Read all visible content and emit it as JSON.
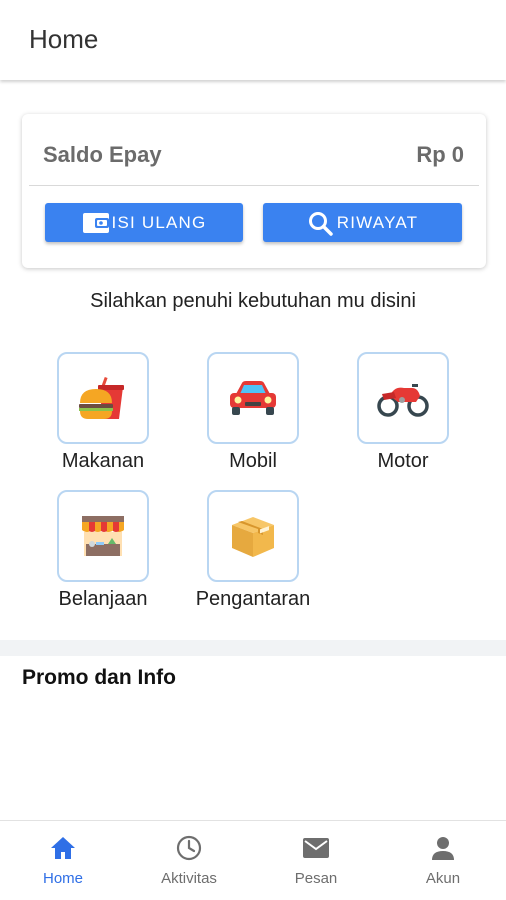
{
  "header": {
    "title": "Home"
  },
  "balance": {
    "label": "Saldo Epay",
    "amount": "Rp 0",
    "topup_label": "ISI ULANG",
    "history_label": "RIWAYAT"
  },
  "subtitle": "Silahkan penuhi kebutuhan mu disini",
  "services": [
    {
      "label": "Makanan",
      "icon": "food-icon"
    },
    {
      "label": "Mobil",
      "icon": "car-icon"
    },
    {
      "label": "Motor",
      "icon": "motorcycle-icon"
    },
    {
      "label": "Belanjaan",
      "icon": "shop-icon"
    },
    {
      "label": "Pengantaran",
      "icon": "package-icon"
    }
  ],
  "promo": {
    "title": "Promo dan Info"
  },
  "bottom_nav": [
    {
      "label": "Home",
      "icon": "home-icon",
      "active": true
    },
    {
      "label": "Aktivitas",
      "icon": "clock-icon",
      "active": false
    },
    {
      "label": "Pesan",
      "icon": "mail-icon",
      "active": false
    },
    {
      "label": "Akun",
      "icon": "person-icon",
      "active": false
    }
  ],
  "colors": {
    "accent": "#3a82f0",
    "nav_active": "#2f6fe6",
    "tile_border": "#b9d6f2"
  }
}
